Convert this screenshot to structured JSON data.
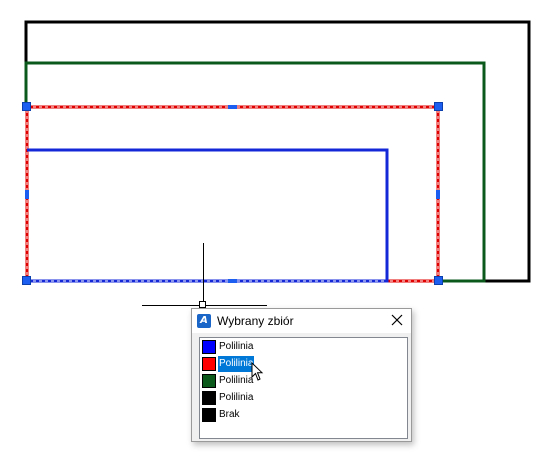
{
  "drawing": {
    "colors": {
      "black_outline": "#000000",
      "green_outline": "#0b5a1c",
      "red_selected": "#e00000",
      "blue_polyline": "#1428d8",
      "grip": "#1c5ff0"
    }
  },
  "dialog": {
    "title": "Wybrany zbiór",
    "app_icon": "autocad-icon",
    "close_icon": "close-icon",
    "items": [
      {
        "label": "Polilinia",
        "color": "#0000ff",
        "selected": false
      },
      {
        "label": "Polilinia",
        "color": "#ff0000",
        "selected": true
      },
      {
        "label": "Polilinia",
        "color": "#0b5a1c",
        "selected": false
      },
      {
        "label": "Polilinia",
        "color": "#000000",
        "selected": false
      },
      {
        "label": "Brak",
        "color": "#000000",
        "selected": false
      }
    ]
  }
}
